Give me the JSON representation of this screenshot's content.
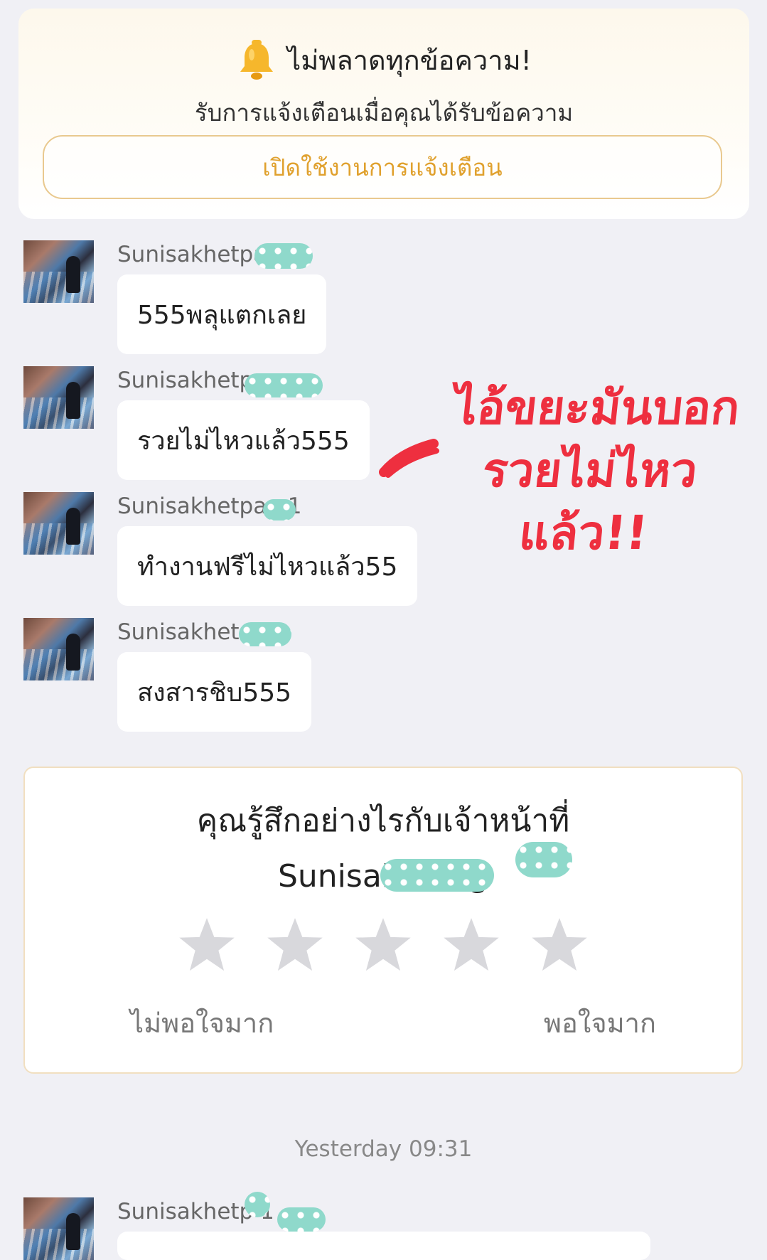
{
  "notification": {
    "icon": "bell-icon",
    "title": "ไม่พลาดทุกข้อความ!",
    "subtitle": "รับการแจ้งเตือนเมื่อคุณได้รับข้อความ",
    "button_label": "เปิดใช้งานการแจ้งเตือน"
  },
  "messages": [
    {
      "sender": "Sunisakhetpa      g1",
      "text": "555พลุแตกเลย"
    },
    {
      "sender": "Sunisakhetp     ung",
      "text": "รวยไม่ไหวแล้ว555"
    },
    {
      "sender": "Sunisakhetpa     g1",
      "text": "ทำงานฟรีไม่ไหวแล้ว55"
    },
    {
      "sender": "Sunisakhet       ng1",
      "text": "สงสารชิบ555"
    },
    {
      "sender": "Sunisakhetp        1",
      "text": ""
    }
  ],
  "overlay": {
    "line1": "ไอ้ขยะมันบอก",
    "line2": "รวยไม่ไหวแล้ว!!",
    "color": "#ee2f3f"
  },
  "rating": {
    "question": "คุณรู้สึกอย่างไรกับเจ้าหน้าที่",
    "agent_name": "Sunisakhe           ng",
    "stars_selected": 0,
    "stars_total": 5,
    "low_label": "ไม่พอใจมาก",
    "high_label": "พอใจมาก"
  },
  "timestamp": "Yesterday 09:31",
  "colors": {
    "accent": "#e0a12e",
    "background": "#f0f0f5",
    "redaction": "#8fd9cb"
  }
}
